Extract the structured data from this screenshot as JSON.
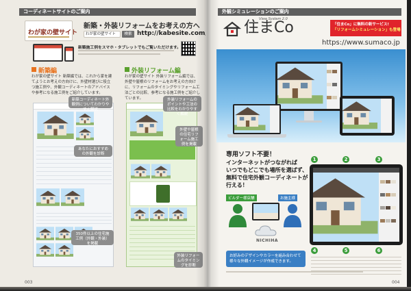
{
  "left_page": {
    "header": "コーディネートサイトのご案内",
    "logo": "わが家の壁サイト",
    "headline": "新築・外装リフォームをお考えの方へ",
    "search_box": "わが家の壁サイト",
    "search_button": "検索",
    "url": "http://kabesite.com/",
    "mobile_note": "新築施工例をスマホ・タブレットでもご覧いただけます。",
    "new_build": {
      "title": "新築編",
      "body": "わが家の壁サイト 新築編では、これから家を建てようとお考えの方向けに、外壁材選びに役立つ施工例や、外観コーディネートのアドバイスや参考になる施工例をご紹介しています。"
    },
    "reform": {
      "title": "外装リフォーム編",
      "body": "わが家の壁サイト 外装リフォーム編では、外壁や屋根のリフォームをお考えの方向けに、リフォームのタイミングやリフォーム工法ごとの比較、参考になる施工例をご紹介しています。"
    },
    "callouts": [
      "新築コーディネート外観例についてわかりやすく解説",
      "あなたにおすすめの外観を診断",
      "350件以上の住宅施工例（外観・外装）を掲載",
      "外装リフォームのポイントや工法の比較をわかりやすく解説",
      "外壁や屋根の住宅リフォーム施工例を掲載",
      "外装リフォームのタイミングを診断"
    ],
    "page_number": "003"
  },
  "right_page": {
    "header": "外観シミュレーションのご案内",
    "logo": "住まCo",
    "logo_tagline": "View System 2.0",
    "promo_line1": "「住まCo」に無料の新サービス!",
    "promo_line2": "「リフォームシミュレーション」も登場",
    "url": "https://www.sumaco.jp",
    "lead": [
      "専用ソフト不要！",
      "インターネットがつながれば",
      "いつでもどこでも場所を選ばず、",
      "無料で住宅外観コーディネートが",
      "行える！"
    ],
    "builder_label": "ビルダー様店舗",
    "owner_label": "お施主様",
    "maker": "NICHIHA",
    "steps": [
      "1",
      "2",
      "3",
      "4",
      "5",
      "6"
    ],
    "bottom_note": "お好みのデザインやカラーを組み合わせて様々な外観イメージが作成できます。",
    "page_number": "004"
  },
  "colors": {
    "new_build_accent": "#e8731f",
    "reform_accent": "#5aa02c",
    "promo_red": "#e0242b",
    "sky_blue": "#3a8fd0",
    "step_green": "#3b9d3b"
  }
}
